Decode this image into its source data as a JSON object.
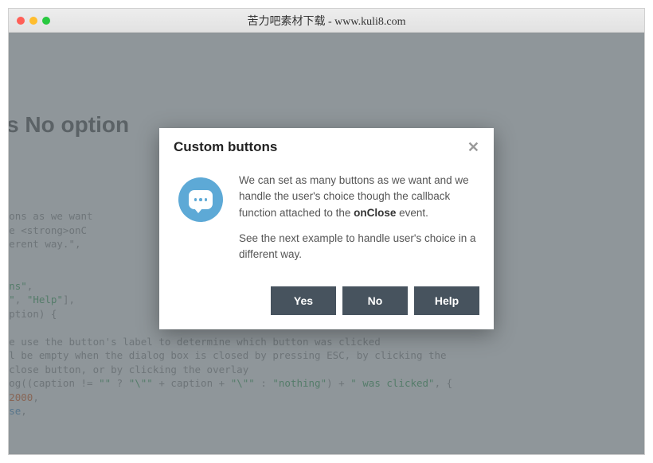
{
  "window": {
    "title": "苦力吧素材下载 - www.kuli8.com"
  },
  "background": {
    "heading_fragment": "h Yes No option",
    "code_html": "any buttons as we wan<span class='cmt'>t</span>                                          \" +\ned to the &lt;strong&gt;onC                                           \" +\nn a different way.\",\n\n<span class='str'>ion\"</span>,\n<span class='str'>om buttons\"</span>,\n<span class='str'>es\"</span>, <span class='str'>\"No\"</span>, <span class='str'>\"Help\"</span>],\n<span class='kw'>ction</span>(caption) {\n\ne that we use the button's label to determine which button was clicked\n<span class='str'>ion\"</span> will be empty when the dialog box is closed by pressing ESC, by clicking the\ng box's close button, or by clicking the overlay\nbra_Dialog((caption != <span class='str'>\"\"</span> ? <span class='str'>\"\\\"\"</span> + caption + <span class='str'>\"\\\"\"</span> : <span class='str'>\"nothing\"</span>) + <span class='str'>\" was clicked\"</span>, {\n_close: <span class='num'>2000</span>,\nons: <span class='kw'>false</span>,"
  },
  "dialog": {
    "title": "Custom buttons",
    "paragraph1_pre": "We can set as many buttons as we want and we handle the user's choice though the callback function attached to the ",
    "paragraph1_strong": "onClose",
    "paragraph1_post": " event.",
    "paragraph2": "See the next example to handle user's choice in a different way.",
    "buttons": {
      "yes": "Yes",
      "no": "No",
      "help": "Help"
    }
  }
}
